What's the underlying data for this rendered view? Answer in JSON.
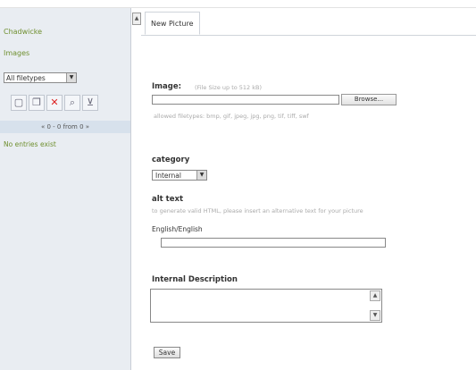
{
  "sidebar": {
    "links": [
      "Chadwicke",
      "Images"
    ],
    "filter_value": "All filetypes",
    "pager": "« 0 - 0 from 0 »",
    "empty_message": "No entries exist",
    "toolbar_icons": [
      "new-icon",
      "copy-icon",
      "delete-icon",
      "search-icon",
      "filter-icon"
    ]
  },
  "tab": {
    "label": "New Picture"
  },
  "form": {
    "image_label": "Image:",
    "image_hint": "(File Size up to 512 kB)",
    "browse_label": "Browse...",
    "allowed_types": "allowed filetypes: bmp, gif, jpeg, jpg, png, tif, tiff, swf",
    "category_label": "category",
    "category_value": "Internal",
    "alt_label": "alt text",
    "alt_hint": "to generate valid HTML, please insert an alternative text for your picture",
    "lang_label": "English/English",
    "desc_label": "Internal Description",
    "save_label": "Save"
  }
}
